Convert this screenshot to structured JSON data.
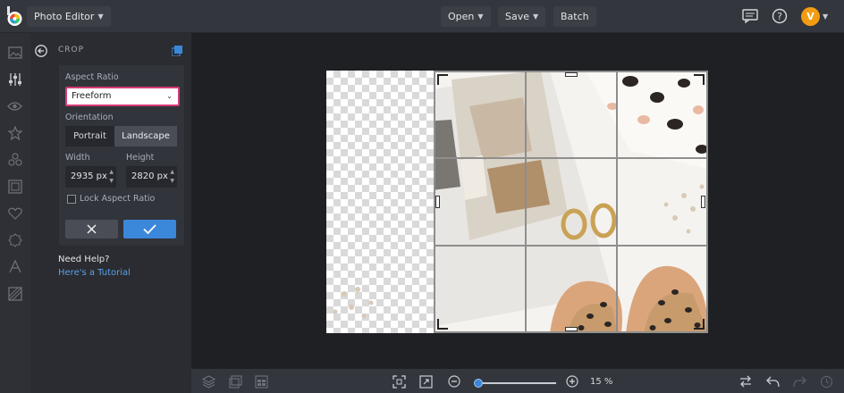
{
  "topbar": {
    "app_title": "Photo Editor",
    "open_label": "Open",
    "save_label": "Save",
    "batch_label": "Batch",
    "avatar_initial": "V"
  },
  "rail": {
    "icons": [
      "image-icon",
      "sliders-icon",
      "eye-icon",
      "star-icon",
      "effects-icon",
      "frame-icon",
      "heart-icon",
      "badge-icon",
      "text-icon",
      "texture-icon"
    ]
  },
  "panel": {
    "title": "CROP",
    "aspect_ratio_label": "Aspect Ratio",
    "aspect_ratio_value": "Freeform",
    "orientation_label": "Orientation",
    "portrait_label": "Portrait",
    "landscape_label": "Landscape",
    "width_label": "Width",
    "height_label": "Height",
    "width_value": "2935",
    "height_value": "2820",
    "unit": "px",
    "lock_label": "Lock Aspect Ratio",
    "lock_checked": false,
    "help_title": "Need Help?",
    "help_link": "Here's a Tutorial"
  },
  "bottombar": {
    "zoom_percent": 15,
    "zoom_label": "15 %",
    "zoom_slider_fraction": 0.05
  },
  "colors": {
    "accent_blue": "#3b87d9",
    "highlight_pink": "#d63a76",
    "avatar_orange": "#f39c12"
  }
}
